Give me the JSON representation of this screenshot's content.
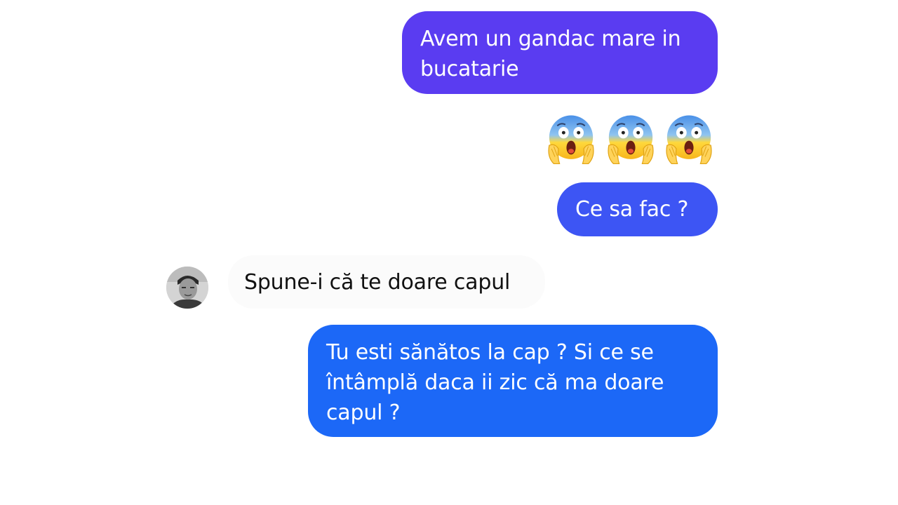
{
  "conversation": {
    "messages": [
      {
        "direction": "outgoing",
        "type": "text",
        "text": "Avem un gandac mare in bucatarie"
      },
      {
        "direction": "outgoing",
        "type": "emoji",
        "emoji_count": 3,
        "emoji_name": "face-screaming-in-fear-icon"
      },
      {
        "direction": "outgoing",
        "type": "text",
        "text": "Ce sa fac ?"
      },
      {
        "direction": "incoming",
        "type": "text",
        "text": "Spune-i că te doare capul",
        "avatar": "contact-avatar"
      },
      {
        "direction": "outgoing",
        "type": "text",
        "text": "Tu esti sănătos la cap ? Si ce se întâmplă daca ii zic că ma doare capul ?"
      }
    ]
  },
  "colors": {
    "background": "#ffffff",
    "bubble_outgoing_top": "#5a3cf1",
    "bubble_outgoing_mid": "#3d55f4",
    "bubble_outgoing_bottom": "#1c68f7",
    "bubble_incoming": "#fbfbfb",
    "text_outgoing": "#ffffff",
    "text_incoming": "#111111"
  }
}
